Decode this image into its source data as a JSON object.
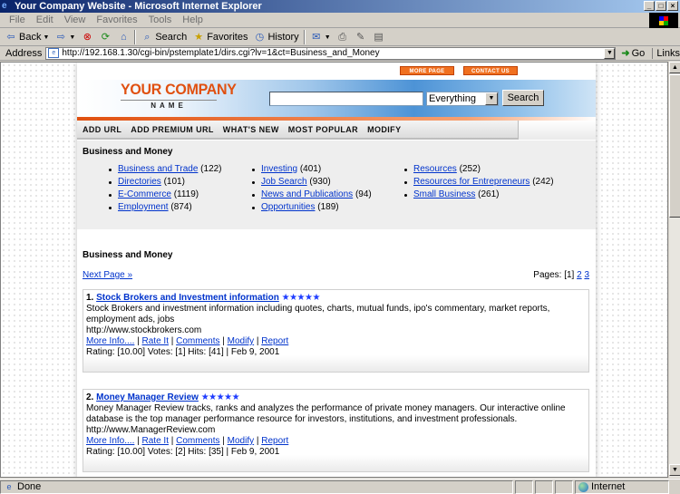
{
  "window": {
    "title": "Your Company Website - Microsoft Internet Explorer",
    "controls": [
      "_",
      "□",
      "×"
    ]
  },
  "menu": [
    "File",
    "Edit",
    "View",
    "Favorites",
    "Tools",
    "Help"
  ],
  "toolbar": {
    "back": "Back",
    "search": "Search",
    "favorites": "Favorites",
    "history": "History"
  },
  "address": {
    "label": "Address",
    "url": "http://192.168.1.30/cgi-bin/pstemplate1/dirs.cgi?lv=1&ct=Business_and_Money",
    "go": "Go",
    "links": "Links"
  },
  "site": {
    "top_links": [
      "MORE PAGE",
      "CONTACT US"
    ],
    "logo": "YOUR COMPANY",
    "logo_sub": "NAME",
    "search_select": "Everything",
    "search_button": "Search",
    "nav": [
      "ADD URL",
      "ADD PREMIUM URL",
      "WHAT'S NEW",
      "MOST POPULAR",
      "MODIFY"
    ],
    "categories_title": "Business and Money",
    "categories": [
      [
        {
          "name": "Business and Trade",
          "count": "(122)"
        },
        {
          "name": "Directories",
          "count": "(101)"
        },
        {
          "name": "E-Commerce",
          "count": "(1119)"
        },
        {
          "name": "Employment",
          "count": "(874)"
        }
      ],
      [
        {
          "name": "Investing",
          "count": "(401)"
        },
        {
          "name": "Job Search",
          "count": "(930)"
        },
        {
          "name": "News and Publications",
          "count": "(94)"
        },
        {
          "name": "Opportunities",
          "count": "(189)"
        }
      ],
      [
        {
          "name": "Resources",
          "count": "(252)"
        },
        {
          "name": "Resources for Entrepreneurs",
          "count": "(242)"
        },
        {
          "name": "Small Business",
          "count": "(261)"
        }
      ]
    ],
    "listings_title": "Business and Money",
    "next_page": "Next Page »",
    "pages_label": "Pages: [1]",
    "pages": [
      "2",
      "3"
    ],
    "listings": [
      {
        "num": "1.",
        "title": "Stock Brokers and Investment information",
        "stars": "★★★★★",
        "desc": "Stock Brokers and investment information including quotes, charts, mutual funds, ipo's commentary, market reports, employment ads, jobs",
        "url": "http://www.stockbrokers.com",
        "actions": [
          "More Info....",
          "Rate It",
          "Comments",
          "Modify",
          "Report"
        ],
        "meta": "Rating: [10.00] Votes: [1] Hits: [41] | Feb 9, 2001"
      },
      {
        "num": "2.",
        "title": "Money Manager Review",
        "stars": "★★★★★",
        "desc": "Money Manager Review tracks, ranks and analyzes the performance of private money managers. Our interactive online database is the top manager performance resource for investors, institutions, and investment professionals.",
        "url": "http://www.ManagerReview.com",
        "actions": [
          "More Info....",
          "Rate It",
          "Comments",
          "Modify",
          "Report"
        ],
        "meta": "Rating: [10.00] Votes: [2] Hits: [35] | Feb 9, 2001"
      }
    ]
  },
  "status": {
    "text": "Done",
    "zone": "Internet"
  }
}
